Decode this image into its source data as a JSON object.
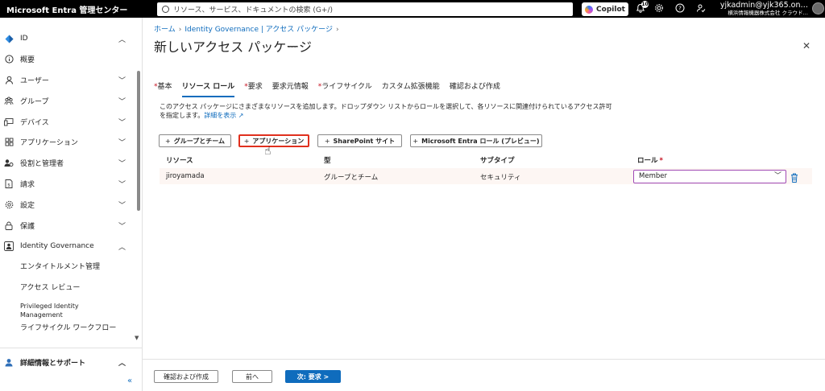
{
  "header": {
    "brand": "Microsoft Entra 管理センター",
    "search_placeholder": "リソース、サービス、ドキュメントの検索 (G+/)",
    "copilot_label": "Copilot",
    "notification_count": "10",
    "user_name": "yjkadmin@yjk365.on…",
    "user_org": "横浜情報機器株式会社 クラウド…"
  },
  "sidebar": {
    "items": [
      {
        "label": "ID",
        "icon": "diamond-icon"
      },
      {
        "label": "概要",
        "icon": "info-icon"
      },
      {
        "label": "ユーザー",
        "icon": "person-icon"
      },
      {
        "label": "グループ",
        "icon": "group-icon"
      },
      {
        "label": "デバイス",
        "icon": "device-icon"
      },
      {
        "label": "アプリケーション",
        "icon": "apps-icon"
      },
      {
        "label": "役割と管理者",
        "icon": "roles-icon"
      },
      {
        "label": "請求",
        "icon": "billing-icon"
      },
      {
        "label": "設定",
        "icon": "gear-icon"
      },
      {
        "label": "保護",
        "icon": "lock-icon"
      },
      {
        "label": "Identity Governance",
        "icon": "governance-icon"
      }
    ],
    "subitems": [
      "エンタイトルメント管理",
      "アクセス レビュー",
      "Privileged Identity Management",
      "ライフサイクル ワークフロー"
    ],
    "support_label": "詳細情報とサポート"
  },
  "breadcrumb": {
    "home": "ホーム",
    "governance": "Identity Governance | アクセス パッケージ"
  },
  "page": {
    "title": "新しいアクセス パッケージ",
    "more": "…"
  },
  "tabs": [
    {
      "label": "基本",
      "required": true
    },
    {
      "label": "リソース ロール",
      "required": false
    },
    {
      "label": "要求",
      "required": true
    },
    {
      "label": "要求元情報",
      "required": false
    },
    {
      "label": "ライフサイクル",
      "required": true
    },
    {
      "label": "カスタム拡張機能",
      "required": false
    },
    {
      "label": "確認および作成",
      "required": false
    }
  ],
  "description": {
    "text": "このアクセス パッケージにさまざまなリソースを追加します。ドロップダウン リストからロールを選択して、各リソースに関連付けられているアクセス許可を指定します。",
    "link": "詳細を表示"
  },
  "add_buttons": [
    "グループとチーム",
    "アプリケーション",
    "SharePoint サイト",
    "Microsoft Entra ロール (プレビュー)"
  ],
  "table": {
    "headers": [
      "リソース",
      "型",
      "サブタイプ",
      "ロール"
    ],
    "rows": [
      {
        "resource": "jiroyamada",
        "type": "グループとチーム",
        "subtype": "セキュリティ",
        "role": "Member"
      }
    ]
  },
  "footer": {
    "review_create": "確認および作成",
    "previous": "前へ",
    "next": "次: 要求 >"
  },
  "colors": {
    "accent": "#0f6cbd",
    "highlight_border": "#e0301e",
    "required": "#c50f1f"
  }
}
